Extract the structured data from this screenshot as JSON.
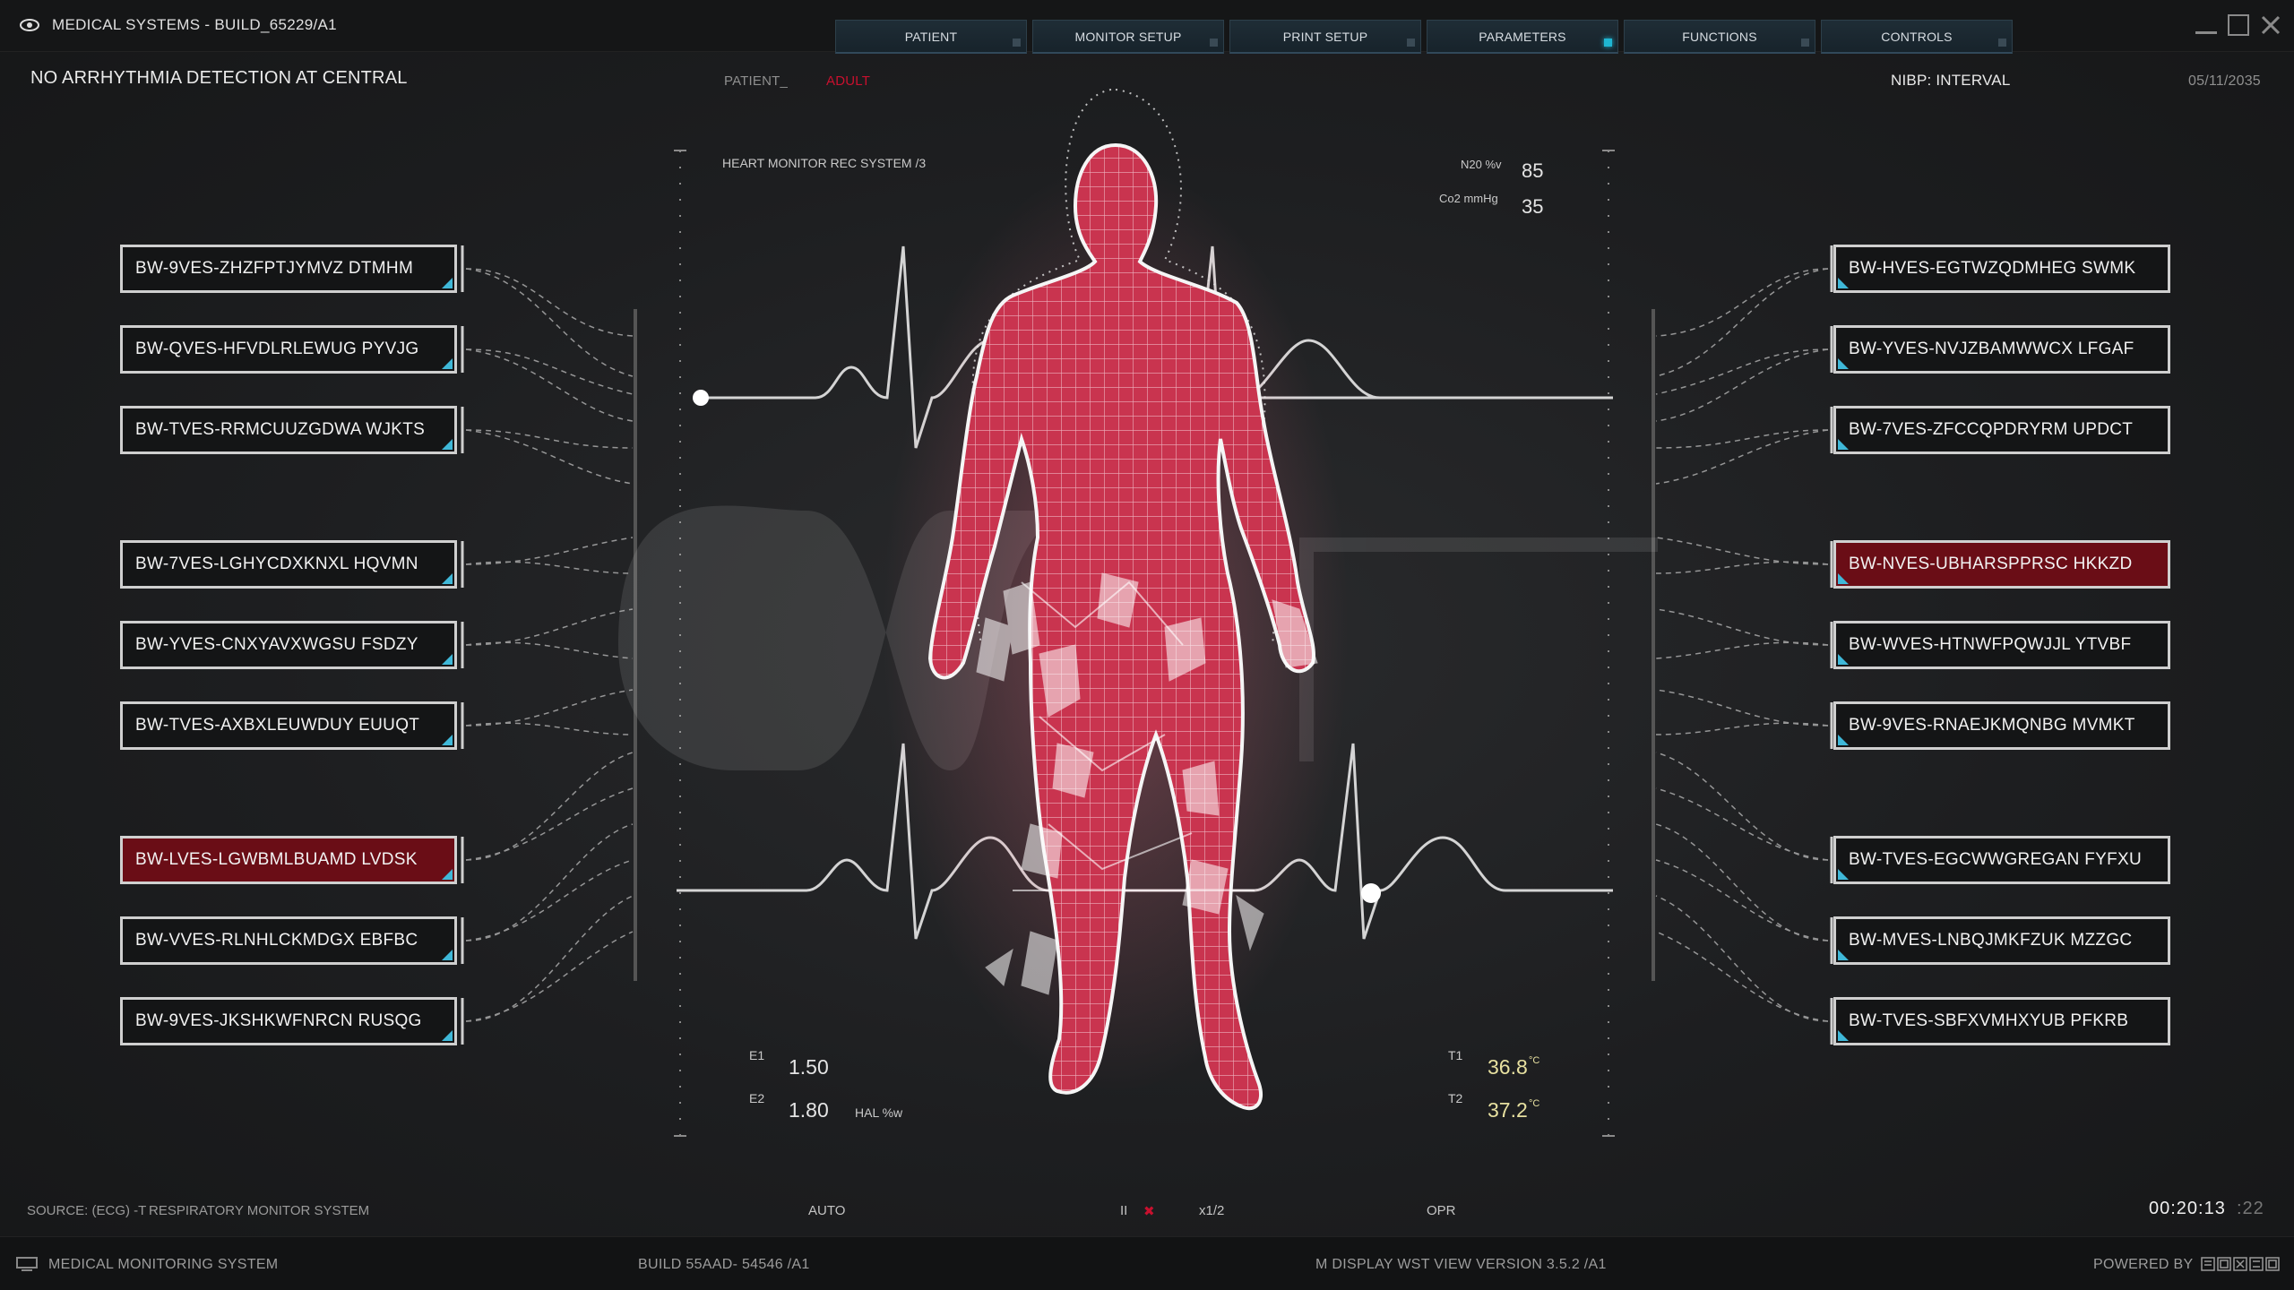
{
  "window": {
    "title": "MEDICAL SYSTEMS - BUILD_65229/A1"
  },
  "tabs": [
    {
      "label": "PATIENT",
      "active": false
    },
    {
      "label": "MONITOR SETUP",
      "active": false
    },
    {
      "label": "PRINT SETUP",
      "active": false
    },
    {
      "label": "PARAMETERS",
      "active": true
    },
    {
      "label": "FUNCTIONS",
      "active": false
    },
    {
      "label": "CONTROLS",
      "active": false
    }
  ],
  "header": {
    "alert_text": "NO ARRHYTHMIA DETECTION AT CENTRAL",
    "patient_label": "PATIENT_",
    "patient_value": "ADULT",
    "nibp": "NIBP: INTERVAL",
    "date": "05/11/2035"
  },
  "monitor": {
    "title": "HEART MONITOR REC SYSTEM /3",
    "n2o_label": "N20 %v",
    "n2o_value": "85",
    "co2_label": "Co2 mmHg",
    "co2_value": "35",
    "e1_label": "E1",
    "e1_value": "1.50",
    "e2_label": "E2",
    "e2_value": "1.80",
    "hal_label": "HAL %w",
    "t1_label": "T1",
    "t1_value": "36.8",
    "t2_label": "T2",
    "t2_value": "37.2",
    "temp_unit": "°C"
  },
  "left_labels": [
    {
      "text": "BW-9VES-ZHZFPTJYMVZ DTMHM",
      "alert": false
    },
    {
      "text": "BW-QVES-HFVDLRLEWUG PYVJG",
      "alert": false
    },
    {
      "text": "BW-TVES-RRMCUUZGDWA WJKTS",
      "alert": false
    },
    {
      "text": "BW-7VES-LGHYCDXKNXL HQVMN",
      "alert": false
    },
    {
      "text": "BW-YVES-CNXYAVXWGSU FSDZY",
      "alert": false
    },
    {
      "text": "BW-TVES-AXBXLEUWDUY EUUQT",
      "alert": false
    },
    {
      "text": "BW-LVES-LGWBMLBUAMD LVDSK",
      "alert": true
    },
    {
      "text": "BW-VVES-RLNHLCKMDGX EBFBC",
      "alert": false
    },
    {
      "text": "BW-9VES-JKSHKWFNRCN RUSQG",
      "alert": false
    }
  ],
  "right_labels": [
    {
      "text": "BW-HVES-EGTWZQDMHEG SWMK",
      "alert": false
    },
    {
      "text": "BW-YVES-NVJZBAMWWCX LFGAF",
      "alert": false
    },
    {
      "text": "BW-7VES-ZFCCQPDRYRM UPDCT",
      "alert": false
    },
    {
      "text": "BW-NVES-UBHARSPPRSC HKKZD",
      "alert": true
    },
    {
      "text": "BW-WVES-HTNWFPQWJJL YTVBF",
      "alert": false
    },
    {
      "text": "BW-9VES-RNAEJKMQNBG MVMKT",
      "alert": false
    },
    {
      "text": "BW-TVES-EGCWWGREGAN FYFXU",
      "alert": false
    },
    {
      "text": "BW-MVES-LNBQJMKFZUK MZZGC",
      "alert": false
    },
    {
      "text": "BW-TVES-SBFXVMHXYUB PFKRB",
      "alert": false
    }
  ],
  "controls": {
    "source": "SOURCE: (ECG) -T",
    "resp": "RESPIRATORY MONITOR SYSTEM",
    "auto": "AUTO",
    "pause": "II",
    "stop": "✖",
    "speed": "x1/2",
    "opr": "OPR",
    "time_main": "00:20:13",
    "time_frac": ":22"
  },
  "footer": {
    "system": "MEDICAL MONITORING SYSTEM",
    "build": "BUILD 55AAD- 54546 /A1",
    "version": "M DISPLAY WST VIEW  VERSION 3.5.2 /A1",
    "powered": "POWERED BY"
  },
  "colors": {
    "accent": "#1fb6d2",
    "alert": "#6a0d16",
    "body": "#d6475f",
    "temp": "#e7e0a0"
  }
}
